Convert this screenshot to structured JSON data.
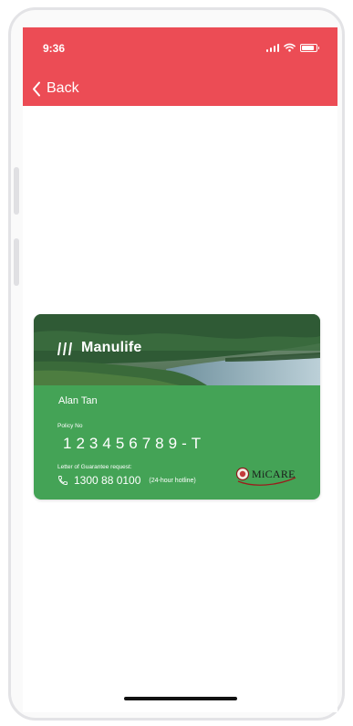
{
  "status_bar": {
    "time": "9:36",
    "icons": [
      "signal-icon",
      "wifi-icon",
      "battery-icon"
    ]
  },
  "header": {
    "back_label": "Back",
    "color": "#ec4c55"
  },
  "card": {
    "brand": "Manulife",
    "member_name": "Alan Tan",
    "policy_label": "Policy No",
    "policy_number": "123456789-T",
    "guarantee_label": "Letter of Guarantee request:",
    "hotline_number": "1300 88 0100",
    "hotline_note": "(24-hour hotline)",
    "partner_logo": "MiCARE",
    "card_color": "#44a356"
  }
}
